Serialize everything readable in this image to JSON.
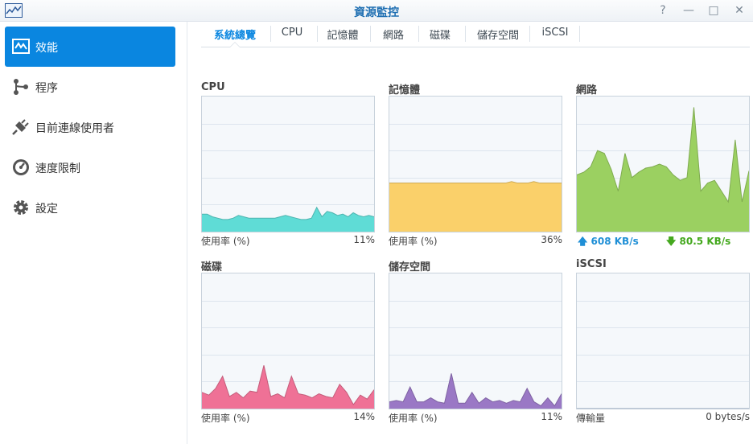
{
  "window": {
    "title": "資源監控",
    "buttons": [
      "?",
      "—",
      "□",
      "✕"
    ]
  },
  "sidebar": {
    "items": [
      {
        "label": "效能",
        "icon": "performance-chart-icon",
        "active": true
      },
      {
        "label": "程序",
        "icon": "process-icon",
        "active": false
      },
      {
        "label": "目前連線使用者",
        "icon": "plug-icon",
        "active": false
      },
      {
        "label": "速度限制",
        "icon": "speedometer-icon",
        "active": false
      },
      {
        "label": "設定",
        "icon": "gear-icon",
        "active": false
      }
    ]
  },
  "tabs": [
    {
      "label": "系統總覽",
      "active": true
    },
    {
      "label": "CPU",
      "active": false
    },
    {
      "label": "記憶體",
      "active": false
    },
    {
      "label": "網路",
      "active": false
    },
    {
      "label": "磁碟",
      "active": false
    },
    {
      "label": "儲存空間",
      "active": false
    },
    {
      "label": "iSCSI",
      "active": false
    }
  ],
  "panels": {
    "cpu": {
      "title": "CPU",
      "label": "使用率 (%)",
      "value": "11%"
    },
    "memory": {
      "title": "記憶體",
      "label": "使用率 (%)",
      "value": "36%"
    },
    "network": {
      "title": "網路",
      "up": "608 KB/s",
      "down": "80.5 KB/s"
    },
    "disk": {
      "title": "磁碟",
      "label": "使用率 (%)",
      "value": "14%"
    },
    "volume": {
      "title": "儲存空間",
      "label": "使用率 (%)",
      "value": "11%"
    },
    "iscsi": {
      "title": "iSCSI",
      "label": "傳輸量",
      "value": "0 bytes/s"
    }
  },
  "chart_data": [
    {
      "type": "area",
      "name": "cpu",
      "color": "#5fdcd6",
      "ylim": [
        0,
        100
      ],
      "values": [
        13,
        13,
        11,
        10,
        9,
        9,
        10,
        12,
        11,
        10,
        10,
        10,
        10,
        10,
        10,
        11,
        12,
        11,
        10,
        9,
        9,
        10,
        18,
        11,
        15,
        14,
        12,
        13,
        11,
        14,
        12,
        11,
        12,
        11
      ]
    },
    {
      "type": "area",
      "name": "memory",
      "color": "#fad06a",
      "ylim": [
        0,
        100
      ],
      "values": [
        36,
        36,
        36,
        36,
        36,
        36,
        36,
        36,
        36,
        36,
        36,
        36,
        36,
        36,
        36,
        36,
        36,
        36,
        36,
        36,
        36,
        36,
        37,
        36,
        36,
        36,
        37,
        36,
        36,
        36,
        36,
        36
      ]
    },
    {
      "type": "area",
      "name": "network",
      "color": "#9bd061",
      "ylim": [
        0,
        100
      ],
      "values": [
        42,
        44,
        48,
        60,
        58,
        46,
        30,
        58,
        40,
        44,
        47,
        48,
        50,
        48,
        42,
        38,
        40,
        92,
        30,
        36,
        38,
        30,
        22,
        68,
        22,
        45
      ]
    },
    {
      "type": "area",
      "name": "disk",
      "color": "#ef7196",
      "ylim": [
        0,
        100
      ],
      "values": [
        12,
        10,
        15,
        24,
        9,
        12,
        8,
        13,
        12,
        32,
        9,
        11,
        8,
        24,
        11,
        10,
        8,
        11,
        9,
        8,
        18,
        12,
        3,
        10,
        7,
        14
      ]
    },
    {
      "type": "area",
      "name": "volume",
      "color": "#9a78c5",
      "ylim": [
        0,
        100
      ],
      "values": [
        5,
        6,
        5,
        16,
        5,
        5,
        8,
        5,
        4,
        26,
        4,
        4,
        12,
        4,
        8,
        5,
        6,
        4,
        6,
        5,
        15,
        5,
        2,
        8,
        2,
        11
      ]
    },
    {
      "type": "area",
      "name": "iscsi",
      "color": "#9bb6d3",
      "ylim": [
        0,
        100
      ],
      "values": [
        0,
        0,
        0,
        0,
        0,
        0,
        0,
        0,
        0,
        0
      ]
    }
  ]
}
